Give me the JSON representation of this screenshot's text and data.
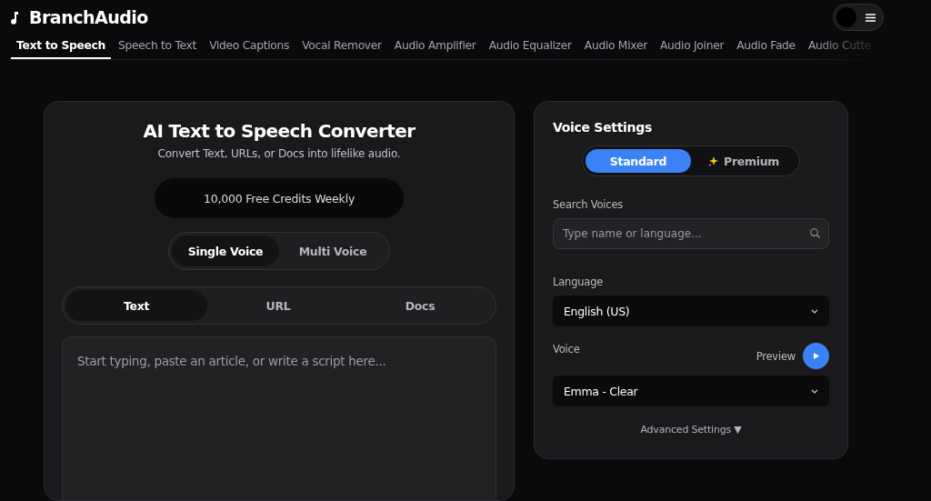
{
  "brand": {
    "name": "BranchAudio"
  },
  "theme_toggle": {
    "on": false
  },
  "nav": [
    {
      "label": "Text to Speech",
      "selected": true
    },
    {
      "label": "Speech to Text",
      "selected": false
    },
    {
      "label": "Video Captions",
      "selected": false
    },
    {
      "label": "Vocal Remover",
      "selected": false
    },
    {
      "label": "Audio Amplifier",
      "selected": false
    },
    {
      "label": "Audio Equalizer",
      "selected": false
    },
    {
      "label": "Audio Mixer",
      "selected": false
    },
    {
      "label": "Audio Joiner",
      "selected": false
    },
    {
      "label": "Audio Fade",
      "selected": false
    },
    {
      "label": "Audio Cutte",
      "selected": false
    }
  ],
  "converter": {
    "title": "AI Text to Speech Converter",
    "subtitle": "Convert Text, URLs, or Docs into lifelike audio.",
    "credits": "10,000 Free Credits Weekly",
    "voice_modes": [
      {
        "label": "Single Voice",
        "selected": true
      },
      {
        "label": "Multi Voice",
        "selected": false
      }
    ],
    "input_tabs": [
      {
        "label": "Text",
        "selected": true
      },
      {
        "label": "URL",
        "selected": false
      },
      {
        "label": "Docs",
        "selected": false
      }
    ],
    "script": {
      "placeholder": "Start typing, paste an article, or write a script here..."
    }
  },
  "voice_settings": {
    "title": "Voice Settings",
    "tiers": [
      {
        "label": "Standard",
        "selected": true
      },
      {
        "label": "Premium",
        "selected": false
      }
    ],
    "search_label": "Search Voices",
    "search": {
      "placeholder": "Type name or language..."
    },
    "language_label": "Language",
    "language": "English (US)",
    "voice_label": "Voice",
    "preview": "Preview",
    "voice": "Emma - Clear",
    "advanced": "Advanced Settings ▼"
  }
}
